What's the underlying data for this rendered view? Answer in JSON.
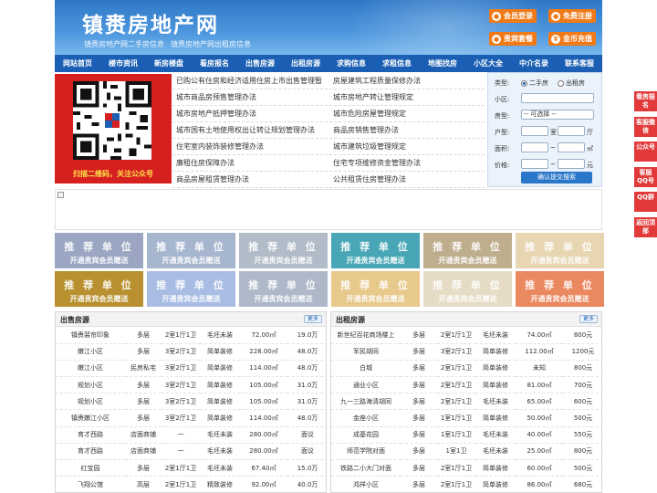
{
  "header": {
    "site_title": "镇赉房地产网",
    "subtitles": [
      "镇赉房地产网二手房信息",
      "镇赉房地产网出租房信息"
    ],
    "buttons": [
      {
        "label": "会员登录",
        "icon": "person-icon"
      },
      {
        "label": "免费注册",
        "icon": "person-icon"
      },
      {
        "label": "贵宾套餐",
        "icon": "person-icon"
      },
      {
        "label": "金币充值",
        "icon": "coin-icon"
      }
    ]
  },
  "nav": {
    "items": [
      "网站首页",
      "楼市资讯",
      "新房楼盘",
      "看房报名",
      "出售房源",
      "出租房源",
      "求购信息",
      "求租信息",
      "地图找房",
      "小区大全",
      "中介名录",
      "联系客服"
    ]
  },
  "qr": {
    "caption": "扫描二维码，关注公众号"
  },
  "links": {
    "col1": [
      "已购公有住房和经济适用住房上市出售管理暂",
      "城市商品房预售管理办法",
      "城市房地产抵押管理办法",
      "城市国有土地使用权出让转让规划管理办法",
      "住宅室内装饰装修管理办法",
      "廉租住房保障办法",
      "商品房屋租赁管理办法"
    ],
    "col2": [
      "房屋建筑工程质量保修办法",
      "城市房地产转让管理规定",
      "城市危险房屋管理规定",
      "商品房销售管理办法",
      "城市建筑垃圾管理规定",
      "住宅专项维修资金管理办法",
      "公共租赁住房管理办法"
    ]
  },
  "search": {
    "type_label": "类型:",
    "type_options": [
      "二手房",
      "出租房"
    ],
    "community_label": "小区:",
    "community_value": "",
    "layout_label": "房型:",
    "layout_value": "-- 可选择 --",
    "rooms_label": "户型:",
    "rooms_unit1": "室",
    "rooms_unit2": "厅",
    "area_label": "面积:",
    "area_unit": "㎡",
    "price_label": "价格:",
    "price_unit": "元",
    "range_sep": "~",
    "submit_label": "确认提交搜索"
  },
  "ads": {
    "title": "推 荐 单 位",
    "subtitle": "开通贵宾会员赠送",
    "colors": [
      "#9aa6c2",
      "#a7b6cf",
      "#b2bcc8",
      "#48a6b6",
      "#bfae8e",
      "#e8d6b3",
      "#b8902f",
      "#a9bce4",
      "#aeb8c8",
      "#e8c98c",
      "#e6dcc6",
      "#ea8860"
    ]
  },
  "sale": {
    "title": "出售房源",
    "more_label": "更多",
    "rows": [
      [
        "镇赉裴帘印象",
        "多层",
        "2室1厅1卫",
        "毛坯未装",
        "72.00㎡",
        "19.0万"
      ],
      [
        "嫩江小区",
        "多层",
        "3室2厅1卫",
        "简单装修",
        "228.00㎡",
        "48.0万"
      ],
      [
        "嫩江小区",
        "民房私宅",
        "3室2厅1卫",
        "简单装修",
        "114.00㎡",
        "48.0万"
      ],
      [
        "规划小区",
        "多层",
        "3室2厅1卫",
        "简单装修",
        "105.00㎡",
        "31.0万"
      ],
      [
        "规划小区",
        "多层",
        "3室2厅1卫",
        "简单装修",
        "105.00㎡",
        "31.0万"
      ],
      [
        "镇赉嫩江小区",
        "多层",
        "3室2厅1卫",
        "简单装修",
        "114.00㎡",
        "48.0万"
      ],
      [
        "育才西路",
        "店面商铺",
        "一",
        "毛坯未装",
        "280.00㎡",
        "面议"
      ],
      [
        "育才西路",
        "店面商铺",
        "一",
        "毛坯未装",
        "280.00㎡",
        "面议"
      ],
      [
        "红宝园",
        "多层",
        "2室1厅1卫",
        "毛坯未装",
        "67.40㎡",
        "15.0万"
      ],
      [
        "飞翔公馆",
        "高层",
        "2室1厅1卫",
        "精致装修",
        "92.00㎡",
        "40.0万"
      ]
    ]
  },
  "rent": {
    "title": "出租房源",
    "more_label": "更多",
    "rows": [
      [
        "新世纪百花商场楼上",
        "多层",
        "2室1厅1卫",
        "毛坯未装",
        "74.00㎡",
        "800元"
      ],
      [
        "军民胡同",
        "多层",
        "3室2厅1卫",
        "简单装修",
        "112.00㎡",
        "1200元"
      ],
      [
        "白城",
        "多层",
        "2室1厅1卫",
        "简单装修",
        "未知",
        "800元"
      ],
      [
        "通业小区",
        "多层",
        "2室1厅1卫",
        "简单装修",
        "81.00㎡",
        "700元"
      ],
      [
        "九一三路海清胡同",
        "多层",
        "2室1厅1卫",
        "毛坯未装",
        "65.00㎡",
        "600元"
      ],
      [
        "金座小区",
        "多层",
        "1室1厅1卫",
        "简单装修",
        "50.00㎡",
        "500元"
      ],
      [
        "成基花园",
        "多层",
        "1室1厅1卫",
        "毛坯未装",
        "40.00㎡",
        "550元"
      ],
      [
        "师范学院对面",
        "多层",
        "1室1卫",
        "毛坯未装",
        "25.00㎡",
        "800元"
      ],
      [
        "铁路二小大门对面",
        "多层",
        "2室1厅1卫",
        "简单装修",
        "60.00㎡",
        "500元"
      ],
      [
        "鸿祥小区",
        "多层",
        "2室1厅1卫",
        "简单装修",
        "86.00㎡",
        "680元"
      ]
    ]
  },
  "float_bar": [
    "看房报名",
    "客服微信",
    "公众号",
    "客服QQ号",
    "QQ群",
    "返回顶部"
  ]
}
